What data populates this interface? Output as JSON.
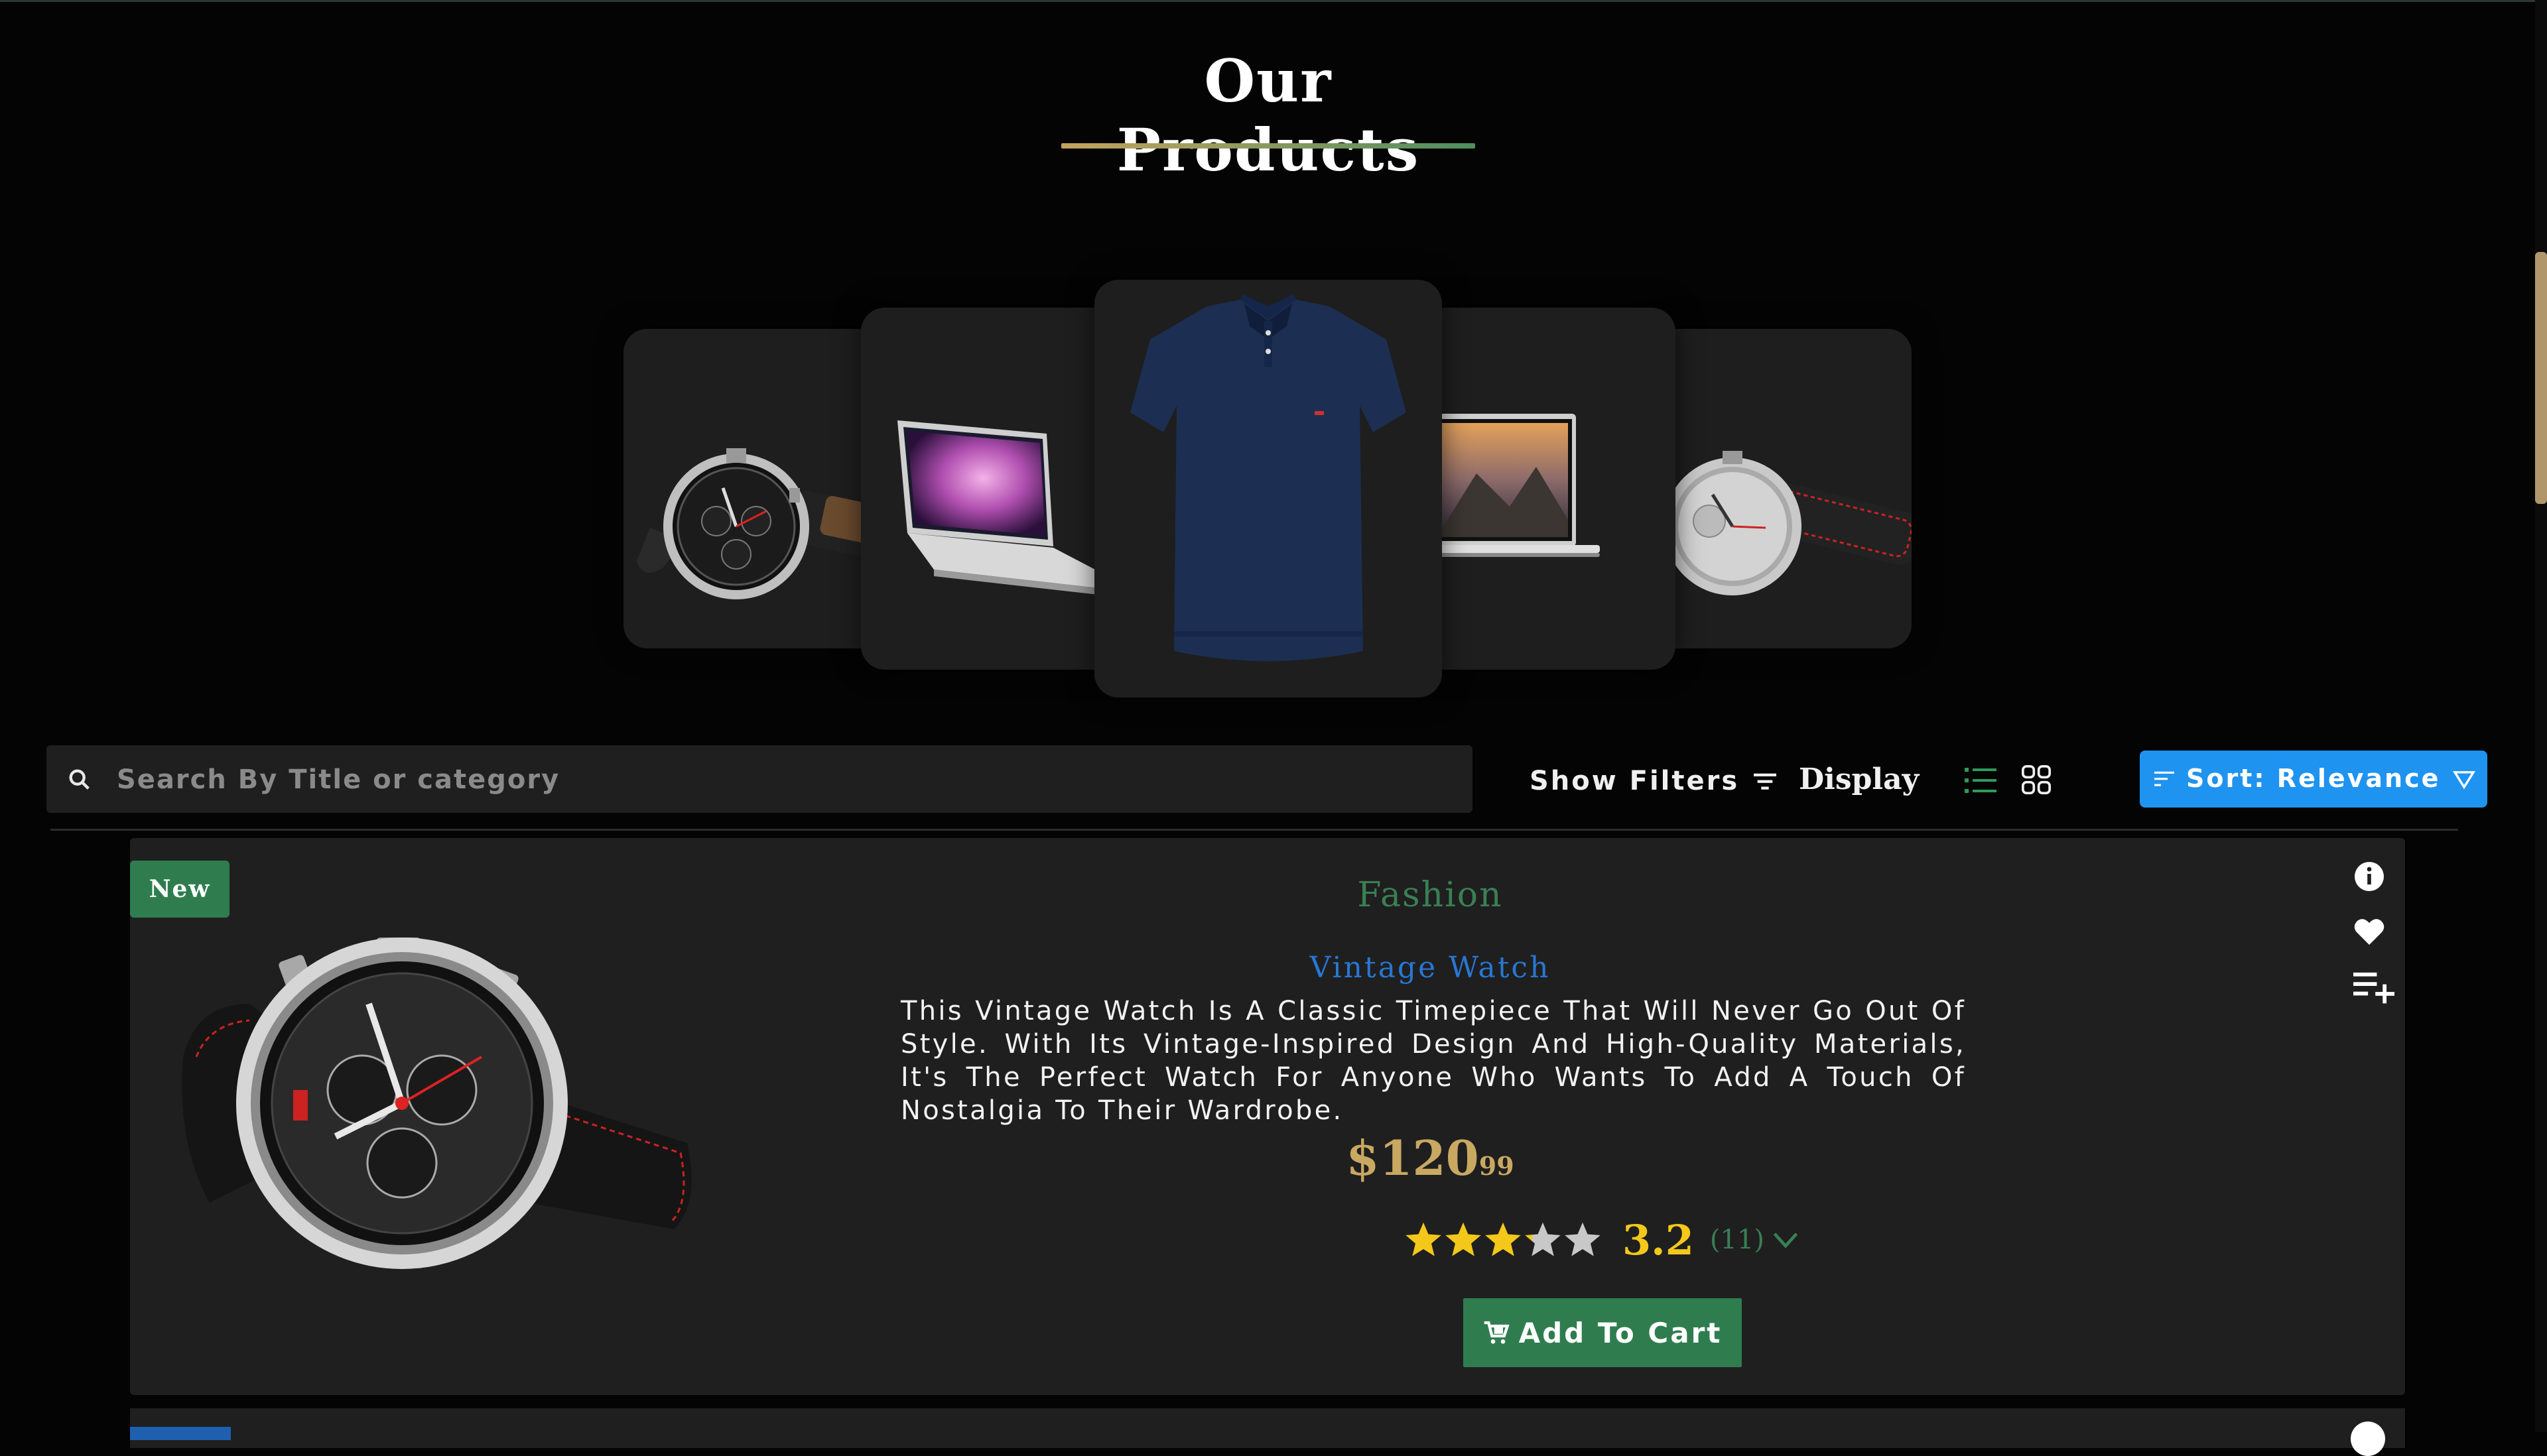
{
  "page": {
    "title": "Our Products"
  },
  "carousel": {
    "items": [
      {
        "icon": "watch-image"
      },
      {
        "icon": "laptop-image"
      },
      {
        "icon": "polo-shirt-image"
      },
      {
        "icon": "laptop-image"
      },
      {
        "icon": "watch-image"
      }
    ]
  },
  "toolbar": {
    "search_placeholder": "Search By Title or category",
    "show_filters_label": "Show Filters",
    "display_label": "Display",
    "sort_label": "Sort: Relevance"
  },
  "product": {
    "badge": "New",
    "category": "Fashion",
    "name": "Vintage Watch",
    "description": "This Vintage Watch Is A Classic Timepiece That Will Never Go Out Of Style. With Its Vintage-Inspired Design And High-Quality Materials, It's The Perfect Watch For Anyone Who Wants To Add A Touch Of Nostalgia To Their Wardrobe.",
    "price_whole": "$120",
    "price_cents": "99",
    "rating_value": "3.2",
    "rating_count": "(11)",
    "stars": 3.2,
    "add_to_cart_label": "Add To Cart"
  },
  "colors": {
    "accent_green": "#2f7d4f",
    "accent_blue": "#1f93f0",
    "price_gold": "#c9a862",
    "star_yellow": "#f3c81a"
  }
}
